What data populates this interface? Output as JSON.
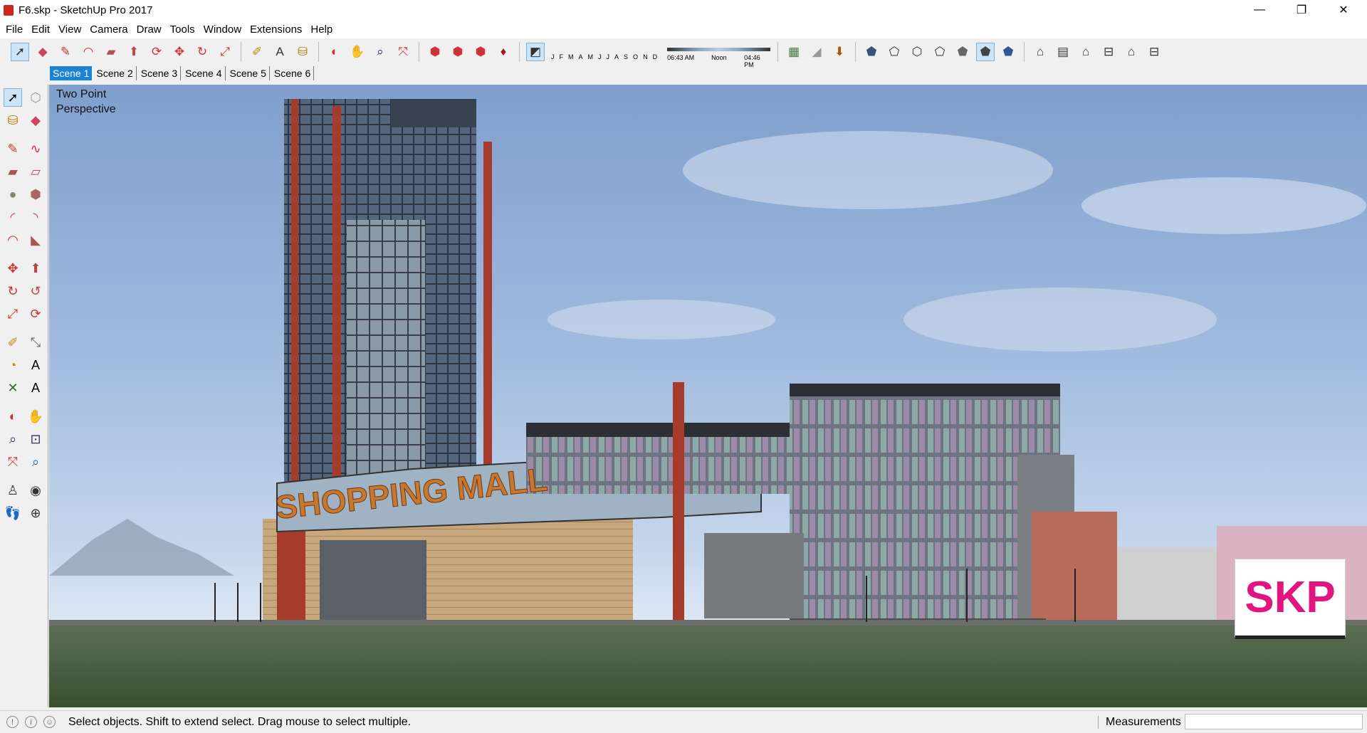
{
  "window": {
    "title": "F6.skp - SketchUp Pro 2017",
    "minimize_icon": "—",
    "maximize_icon": "❐",
    "close_icon": "✕"
  },
  "menu": [
    "File",
    "Edit",
    "View",
    "Camera",
    "Draw",
    "Tools",
    "Window",
    "Extensions",
    "Help"
  ],
  "shadow": {
    "months": [
      "J",
      "F",
      "M",
      "A",
      "M",
      "J",
      "J",
      "A",
      "S",
      "O",
      "N",
      "D"
    ],
    "time_start": "06:43 AM",
    "time_mid": "Noon",
    "time_end": "04:46 PM"
  },
  "scenes": [
    "Scene 1",
    "Scene 2",
    "Scene 3",
    "Scene 4",
    "Scene 5",
    "Scene 6"
  ],
  "active_scene": "Scene 1",
  "viewport": {
    "camera_label": "Two Point Perspective",
    "camera_line1": "Two Point",
    "camera_line2": "Perspective",
    "sign_text": "SHOPPING MALL",
    "logo_text": "SKP"
  },
  "status": {
    "message": "Select objects. Shift to extend select. Drag mouse to select multiple.",
    "measurements_label": "Measurements",
    "measurements_value": ""
  },
  "colors": {
    "accent": "#1883d7",
    "logo": "#e0157f",
    "facade_red": "#a63b2c"
  }
}
